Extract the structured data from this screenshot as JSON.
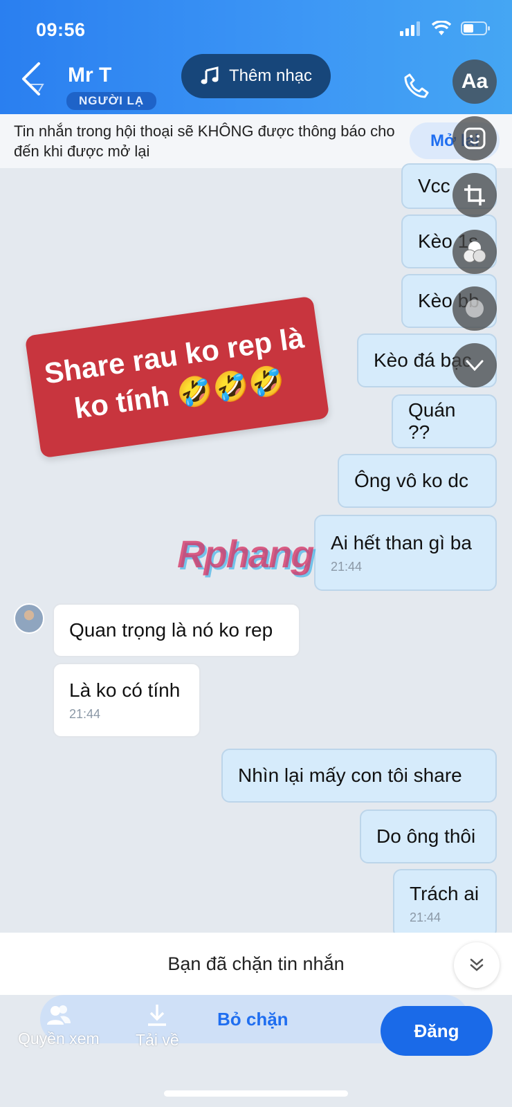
{
  "status": {
    "time": "09:56"
  },
  "header": {
    "contact_name": "Mr T",
    "stranger_badge": "NGƯỜI LẠ",
    "music_label": "Thêm nhạc"
  },
  "story_tools": {
    "text_tool": "Aa"
  },
  "notice": {
    "text": "Tin nhắn trong hội thoại sẽ KHÔNG được thông báo cho đến khi được mở lại",
    "button": "Mở lại"
  },
  "messages": [
    {
      "side": "me",
      "text": "Vcc"
    },
    {
      "side": "me",
      "text": "Kèo 1s"
    },
    {
      "side": "me",
      "text": "Kèo bb"
    },
    {
      "side": "me",
      "text": "Kèo đá bạc"
    },
    {
      "side": "me",
      "text": "Quán ??"
    },
    {
      "side": "me",
      "text": "Ông vô ko dc"
    },
    {
      "side": "me",
      "text": "Ai hết than gì ba",
      "time": "21:44"
    },
    {
      "side": "them",
      "text": "Quan trọng là nó ko rep"
    },
    {
      "side": "them",
      "text": "Là ko có tính",
      "time": "21:44"
    },
    {
      "side": "me",
      "text": "Nhìn lại mấy con tôi share"
    },
    {
      "side": "me",
      "text": "Do ông thôi"
    },
    {
      "side": "me",
      "text": "Trách ai",
      "time": "21:44"
    }
  ],
  "sticker": {
    "line1": "Share rau ko rep là",
    "line2": "ko tính 🤣🤣🤣"
  },
  "watermark": "Rphang",
  "blocked": {
    "text": "Bạn đã chặn tin nhắn",
    "unblock_label": "Bỏ chặn"
  },
  "bottom_bar": {
    "privacy_label": "Quyền xem",
    "download_label": "Tải về",
    "post_label": "Đăng"
  },
  "colors": {
    "header_blue": "#2a7ff0",
    "accent_blue": "#1f6ef0",
    "sticker_red": "#c8353e",
    "my_bubble": "#d6ebfb"
  }
}
